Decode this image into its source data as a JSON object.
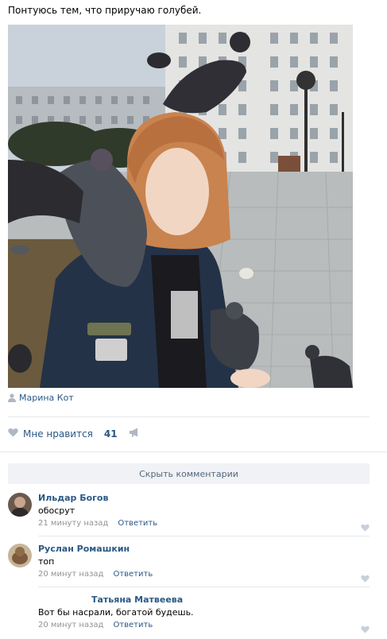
{
  "post": {
    "text": "Понтуюсь тем, что приручаю голубей.",
    "author": "Марина Кот",
    "likes_label": "Мне нравится",
    "likes_count": "41"
  },
  "comments_toggle": "Скрыть комментарии",
  "comments": [
    {
      "author": "Ильдар Богов",
      "text": "обосрут",
      "time": "21 минуту назад",
      "reply": "Ответить"
    },
    {
      "author": "Руслан Ромашкин",
      "text": "топ",
      "time": "20 минут назад",
      "reply": "Ответить"
    },
    {
      "author": "Татьяна Матвеева",
      "text": "Вот бы насрали, богатой будешь.",
      "time": "20 минут назад",
      "reply": "Ответить"
    }
  ],
  "colors": {
    "link": "#2a5885",
    "meta": "#939393",
    "button_bg": "#f0f2f5",
    "divider": "#e7e8ec"
  },
  "icons": [
    "user-icon",
    "heart-icon",
    "megaphone-icon"
  ]
}
